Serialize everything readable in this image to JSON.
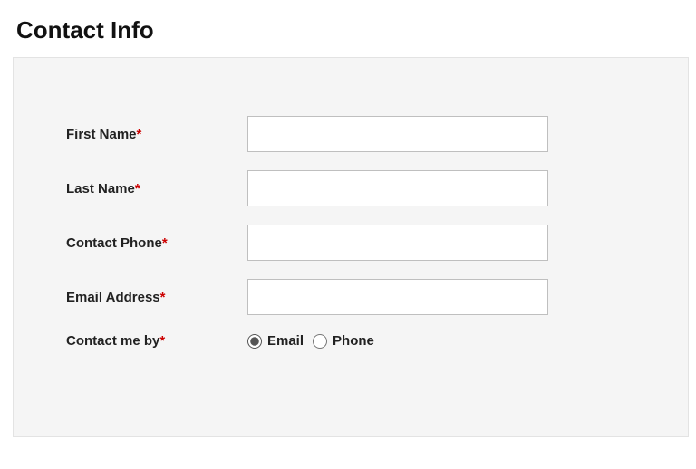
{
  "title": "Contact Info",
  "required_marker": "*",
  "fields": {
    "first_name": {
      "label": "First Name",
      "value": ""
    },
    "last_name": {
      "label": "Last Name",
      "value": ""
    },
    "contact_phone": {
      "label": "Contact Phone",
      "value": ""
    },
    "email_address": {
      "label": "Email Address",
      "value": ""
    }
  },
  "contact_by": {
    "label": "Contact me by",
    "options": {
      "email": "Email",
      "phone": "Phone"
    },
    "selected": "email"
  }
}
